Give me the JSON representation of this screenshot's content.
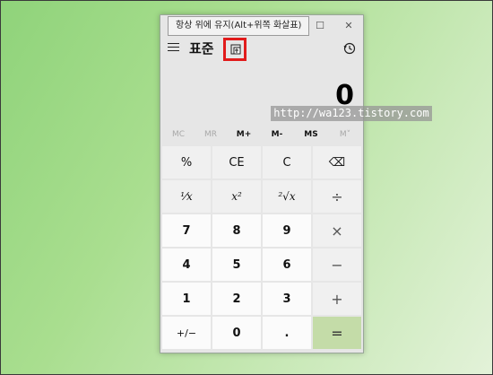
{
  "tooltip": "항상 위에 유지(Alt+위쪽 화살표)",
  "window": {
    "minimize": "—",
    "maximize": "☐",
    "close": "✕"
  },
  "header": {
    "title": "표준"
  },
  "display": {
    "value": "0"
  },
  "watermark": "http://wa123.tistory.com",
  "memory": {
    "mc": "MC",
    "mr": "MR",
    "mplus": "M+",
    "mminus": "M-",
    "ms": "MS",
    "mlist": "M˅"
  },
  "keys": {
    "percent": "%",
    "ce": "CE",
    "c": "C",
    "backspace": "⌫",
    "reciprocal": "¹⁄x",
    "square": "x²",
    "sqrt": "²√x",
    "divide": "÷",
    "n7": "7",
    "n8": "8",
    "n9": "9",
    "multiply": "×",
    "n4": "4",
    "n5": "5",
    "n6": "6",
    "minus": "−",
    "n1": "1",
    "n2": "2",
    "n3": "3",
    "plus": "+",
    "negate": "+/−",
    "n0": "0",
    "decimal": ".",
    "equals": "="
  },
  "colors": {
    "highlight_border": "#e11b1b",
    "equals_bg": "#c4dca8",
    "wallpaper": "#a9de8f"
  }
}
